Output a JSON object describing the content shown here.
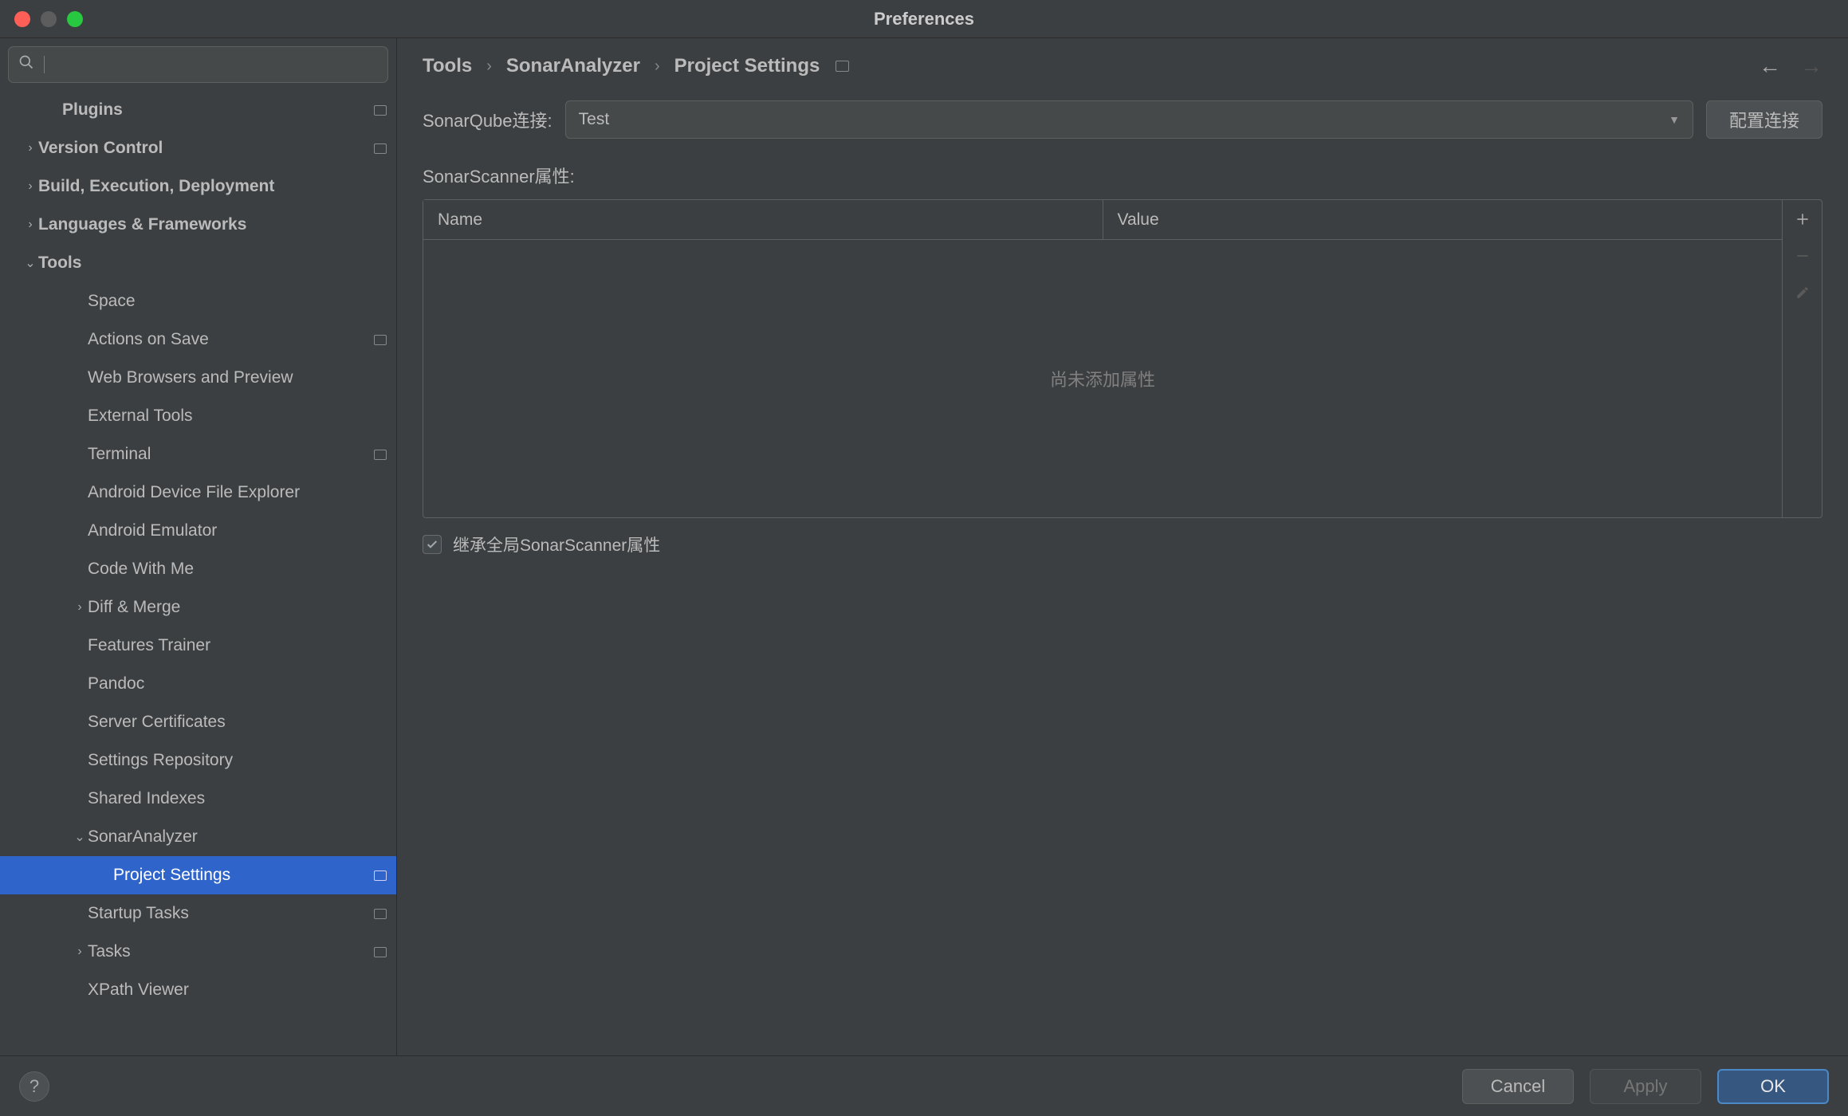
{
  "window": {
    "title": "Preferences"
  },
  "search": {
    "placeholder": ""
  },
  "sidebar": {
    "items": [
      {
        "label": "Plugins",
        "indent": 2,
        "arrow": "",
        "badge": true
      },
      {
        "label": "Version Control",
        "indent": 1,
        "arrow": "right",
        "badge": true
      },
      {
        "label": "Build, Execution, Deployment",
        "indent": 1,
        "arrow": "right",
        "badge": false
      },
      {
        "label": "Languages & Frameworks",
        "indent": 1,
        "arrow": "right",
        "badge": false
      },
      {
        "label": "Tools",
        "indent": 1,
        "arrow": "down",
        "badge": false
      },
      {
        "label": "Space",
        "indent": 3,
        "arrow": "",
        "badge": false,
        "child": true
      },
      {
        "label": "Actions on Save",
        "indent": 3,
        "arrow": "",
        "badge": true,
        "child": true
      },
      {
        "label": "Web Browsers and Preview",
        "indent": 3,
        "arrow": "",
        "badge": false,
        "child": true
      },
      {
        "label": "External Tools",
        "indent": 3,
        "arrow": "",
        "badge": false,
        "child": true
      },
      {
        "label": "Terminal",
        "indent": 3,
        "arrow": "",
        "badge": true,
        "child": true
      },
      {
        "label": "Android Device File Explorer",
        "indent": 3,
        "arrow": "",
        "badge": false,
        "child": true
      },
      {
        "label": "Android Emulator",
        "indent": 3,
        "arrow": "",
        "badge": false,
        "child": true
      },
      {
        "label": "Code With Me",
        "indent": 3,
        "arrow": "",
        "badge": false,
        "child": true
      },
      {
        "label": "Diff & Merge",
        "indent": 3,
        "arrow": "right",
        "badge": false,
        "child": true
      },
      {
        "label": "Features Trainer",
        "indent": 3,
        "arrow": "",
        "badge": false,
        "child": true
      },
      {
        "label": "Pandoc",
        "indent": 3,
        "arrow": "",
        "badge": false,
        "child": true
      },
      {
        "label": "Server Certificates",
        "indent": 3,
        "arrow": "",
        "badge": false,
        "child": true
      },
      {
        "label": "Settings Repository",
        "indent": 3,
        "arrow": "",
        "badge": false,
        "child": true
      },
      {
        "label": "Shared Indexes",
        "indent": 3,
        "arrow": "",
        "badge": false,
        "child": true
      },
      {
        "label": "SonarAnalyzer",
        "indent": 3,
        "arrow": "down",
        "badge": false,
        "child": true
      },
      {
        "label": "Project Settings",
        "indent": 4,
        "arrow": "",
        "badge": true,
        "child": true,
        "selected": true
      },
      {
        "label": "Startup Tasks",
        "indent": 3,
        "arrow": "",
        "badge": true,
        "child": true
      },
      {
        "label": "Tasks",
        "indent": 3,
        "arrow": "right",
        "badge": true,
        "child": true
      },
      {
        "label": "XPath Viewer",
        "indent": 3,
        "arrow": "",
        "badge": false,
        "child": true
      }
    ]
  },
  "breadcrumb": {
    "p0": "Tools",
    "p1": "SonarAnalyzer",
    "p2": "Project Settings"
  },
  "form": {
    "connection_label": "SonarQube连接:",
    "connection_value": "Test",
    "config_connection_btn": "配置连接",
    "props_label": "SonarScanner属性:",
    "col_name": "Name",
    "col_value": "Value",
    "empty_text": "尚未添加属性",
    "inherit_label": "继承全局SonarScanner属性",
    "inherit_checked": true
  },
  "footer": {
    "cancel": "Cancel",
    "apply": "Apply",
    "ok": "OK"
  }
}
